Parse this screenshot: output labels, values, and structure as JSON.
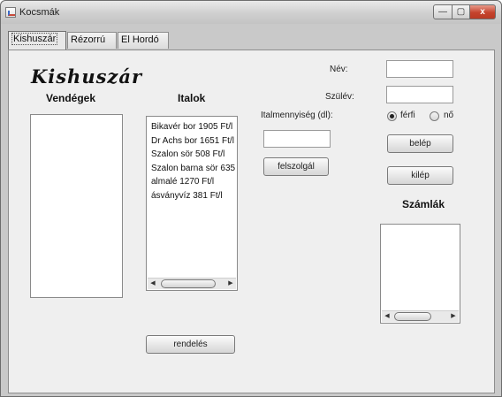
{
  "window": {
    "title": "Kocsmák",
    "controls": {
      "minimize": "—",
      "maximize": "▢",
      "close": "x"
    }
  },
  "tabs": [
    {
      "label": "Kishuszár",
      "active": true
    },
    {
      "label": "Rézorrú",
      "active": false
    },
    {
      "label": "El Hordó",
      "active": false
    }
  ],
  "panel": {
    "brand": "Kishuszár",
    "guests_heading": "Vendégek",
    "drinks_heading": "Italok",
    "drinks": [
      "Bikavér bor 1905 Ft/l",
      "Dr Achs bor 1651 Ft/l",
      "Szalon sör 508 Ft/l",
      "Szalon barna sör 635",
      "almalé 1270 Ft/l",
      "ásványvíz 381 Ft/l"
    ],
    "quantity_label": "Italmennyiség (dl):",
    "quantity_value": "",
    "serve_button": "felszolgál",
    "order_button": "rendelés",
    "name_label": "Név:",
    "name_value": "",
    "birthyear_label": "Szülév:",
    "birthyear_value": "",
    "gender": {
      "male_label": "férfi",
      "female_label": "nő",
      "selected": "férfi"
    },
    "login_button": "belép",
    "logout_button": "kilép",
    "bills_heading": "Számlák"
  }
}
